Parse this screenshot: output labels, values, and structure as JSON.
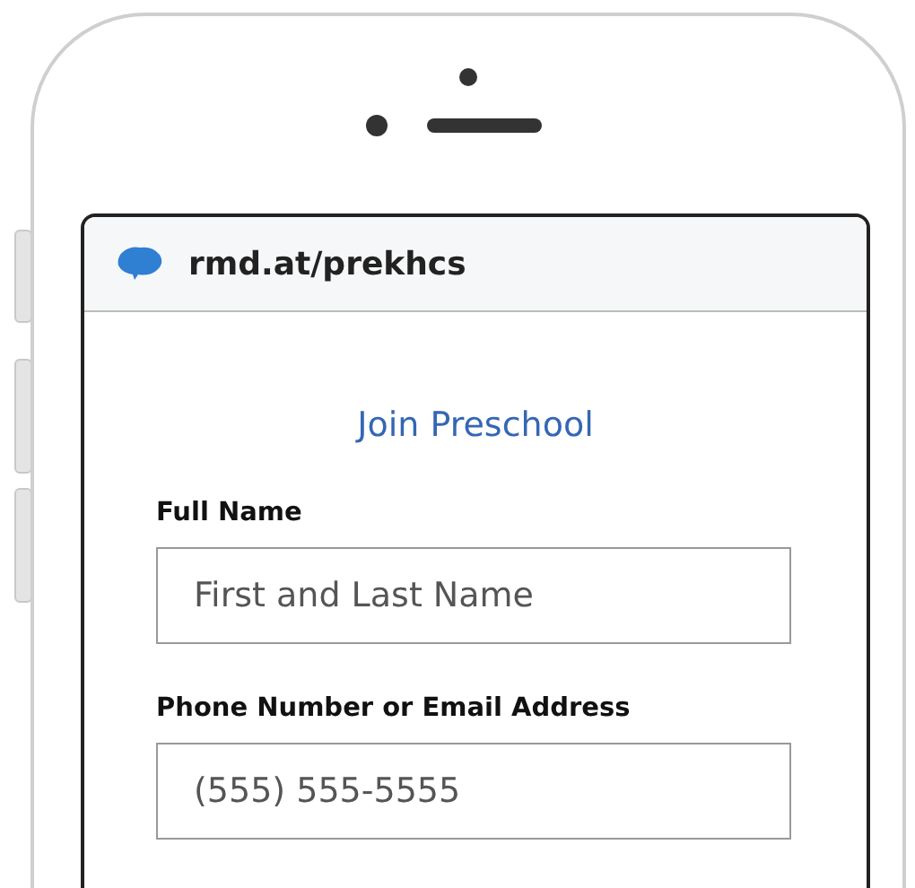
{
  "address_bar": {
    "url": "rmd.at/prekhcs"
  },
  "form": {
    "title": "Join Preschool",
    "fields": [
      {
        "label": "Full Name",
        "placeholder": "First and Last Name"
      },
      {
        "label": "Phone Number or Email Address",
        "placeholder": "(555) 555-5555"
      }
    ]
  }
}
